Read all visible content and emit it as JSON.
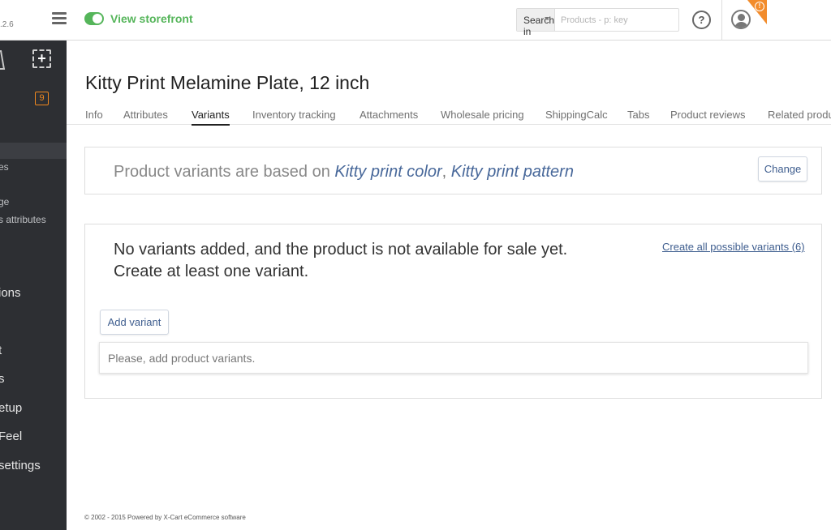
{
  "header": {
    "version": ".2.6",
    "storefront_label": "View storefront",
    "search_in_label": "Search in",
    "search_placeholder": "Products - p: key",
    "help_label": "?"
  },
  "sidebar": {
    "badge_count": "9",
    "items": [
      {
        "label": "es"
      },
      {
        "label": "ge"
      },
      {
        "label": "s attributes"
      },
      {
        "label": "ions"
      },
      {
        "label": "t"
      },
      {
        "label": "s"
      },
      {
        "label": "etup"
      },
      {
        "label": "Feel"
      },
      {
        "label": "settings"
      }
    ]
  },
  "main": {
    "title": "Kitty Print Melamine Plate, 12 inch",
    "tabs": [
      {
        "label": "Info"
      },
      {
        "label": "Attributes"
      },
      {
        "label": "Variants",
        "active": true
      },
      {
        "label": "Inventory tracking"
      },
      {
        "label": "Attachments"
      },
      {
        "label": "Wholesale pricing"
      },
      {
        "label": "ShippingCalc"
      },
      {
        "label": "Tabs"
      },
      {
        "label": "Product reviews"
      },
      {
        "label": "Related produ"
      }
    ],
    "variants_based_prefix": "Product variants are based on ",
    "attribute_1": "Kitty print color",
    "attribute_sep": ",",
    "attribute_2": "Kitty print pattern",
    "change_button": "Change",
    "notice": "No variants added, and the product is not available for sale yet. Create at least one variant.",
    "create_all_link": "Create all possible variants (6)",
    "add_variant_button": "Add variant",
    "empty_message": "Please, add product variants."
  },
  "footer": {
    "text": "© 2002 - 2015 Powered by X-Cart eCommerce software"
  },
  "colors": {
    "accent_green": "#55b55a",
    "link_blue": "#3f5e8f",
    "sidebar_bg": "#2d2f33",
    "alert_orange": "#f28c2c"
  }
}
